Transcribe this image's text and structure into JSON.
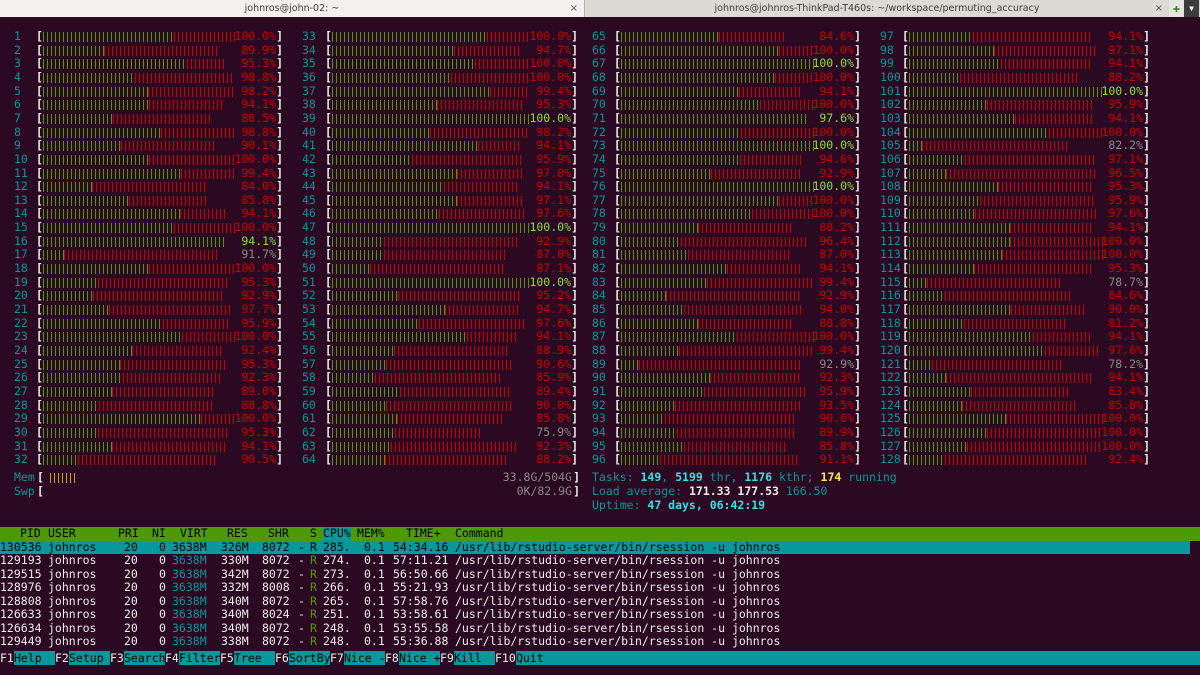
{
  "tabs": [
    {
      "title": "johnros@john-02: ~",
      "close": "×",
      "active": true
    },
    {
      "title": "johnros@johnros-ThinkPad-T460s: ~/workspace/permuting_accuracy",
      "close": "×",
      "active": false
    }
  ],
  "tab_buttons": {
    "new_tab": "✚",
    "menu": "▼"
  },
  "cpus": [
    [
      "1",
      "100.0%",
      0.68
    ],
    [
      "2",
      "89.9%",
      0.35
    ],
    [
      "3",
      "95.3%",
      0.78
    ],
    [
      "4",
      "98.8%",
      0.48
    ],
    [
      "5",
      "98.2%",
      0.55
    ],
    [
      "6",
      "94.1%",
      0.58
    ],
    [
      "7",
      "86.5%",
      0.42
    ],
    [
      "8",
      "98.8%",
      0.62
    ],
    [
      "9",
      "90.1%",
      0.45
    ],
    [
      "10",
      "100.0%",
      0.55
    ],
    [
      "11",
      "99.4%",
      0.72
    ],
    [
      "12",
      "84.0%",
      0.3
    ],
    [
      "13",
      "85.8%",
      0.52
    ],
    [
      "14",
      "94.1%",
      0.75
    ],
    [
      "15",
      "100.0%",
      0.68
    ],
    [
      "16",
      "94.1%",
      1.0
    ],
    [
      "17",
      "91.7%",
      0.12
    ],
    [
      "18",
      "100.0%",
      0.55
    ],
    [
      "19",
      "95.3%",
      0.3
    ],
    [
      "20",
      "92.9%",
      0.28
    ],
    [
      "21",
      "97.7%",
      0.35
    ],
    [
      "22",
      "95.9%",
      0.65
    ],
    [
      "23",
      "100.0%",
      0.72
    ],
    [
      "24",
      "92.4%",
      0.5
    ],
    [
      "25",
      "95.3%",
      0.42
    ],
    [
      "26",
      "92.3%",
      0.45
    ],
    [
      "27",
      "89.0%",
      0.4
    ],
    [
      "28",
      "88.8%",
      0.33
    ],
    [
      "29",
      "100.0%",
      0.82
    ],
    [
      "30",
      "95.3%",
      0.3
    ],
    [
      "31",
      "94.1%",
      0.38
    ],
    [
      "32",
      "90.5%",
      0.2
    ],
    [
      "33",
      "100.0%",
      0.78
    ],
    [
      "34",
      "94.7%",
      0.65
    ],
    [
      "35",
      "100.0%",
      0.72
    ],
    [
      "36",
      "100.0%",
      0.6
    ],
    [
      "37",
      "99.4%",
      0.8
    ],
    [
      "38",
      "95.3%",
      0.55
    ],
    [
      "39",
      "100.0%",
      1.0
    ],
    [
      "40",
      "98.2%",
      0.5
    ],
    [
      "41",
      "94.1%",
      0.78
    ],
    [
      "42",
      "95.9%",
      0.42
    ],
    [
      "43",
      "97.0%",
      0.65
    ],
    [
      "44",
      "94.1%",
      0.6
    ],
    [
      "45",
      "97.1%",
      0.65
    ],
    [
      "46",
      "97.6%",
      0.55
    ],
    [
      "47",
      "100.0%",
      1.0
    ],
    [
      "48",
      "92.9%",
      0.28
    ],
    [
      "49",
      "87.0%",
      0.3
    ],
    [
      "50",
      "87.1%",
      0.22
    ],
    [
      "51",
      "100.0%",
      1.0
    ],
    [
      "52",
      "95.2%",
      0.35
    ],
    [
      "53",
      "94.7%",
      0.6
    ],
    [
      "54",
      "97.6%",
      0.45
    ],
    [
      "55",
      "94.1%",
      0.72
    ],
    [
      "56",
      "88.9%",
      0.35
    ],
    [
      "57",
      "90.6%",
      0.3
    ],
    [
      "58",
      "85.9%",
      0.25
    ],
    [
      "59",
      "89.4%",
      0.38
    ],
    [
      "60",
      "90.0%",
      0.3
    ],
    [
      "61",
      "85.8%",
      0.38
    ],
    [
      "62",
      "75.9%",
      0.42
    ],
    [
      "63",
      "92.3%",
      0.32
    ],
    [
      "64",
      "88.2%",
      0.3
    ],
    [
      "65",
      "84.6%",
      0.6
    ],
    [
      "66",
      "100.0%",
      0.82
    ],
    [
      "67",
      "100.0%",
      1.0
    ],
    [
      "68",
      "100.0%",
      0.8
    ],
    [
      "69",
      "94.1%",
      0.65
    ],
    [
      "70",
      "100.0%",
      0.72
    ],
    [
      "71",
      "97.6%",
      1.0
    ],
    [
      "72",
      "100.0%",
      0.62
    ],
    [
      "73",
      "100.0%",
      1.0
    ],
    [
      "74",
      "94.6%",
      0.65
    ],
    [
      "75",
      "92.9%",
      0.5
    ],
    [
      "76",
      "100.0%",
      1.0
    ],
    [
      "77",
      "100.0%",
      0.82
    ],
    [
      "78",
      "100.0%",
      0.68
    ],
    [
      "79",
      "88.2%",
      0.45
    ],
    [
      "80",
      "96.4%",
      0.32
    ],
    [
      "81",
      "87.0%",
      0.4
    ],
    [
      "82",
      "94.1%",
      0.58
    ],
    [
      "83",
      "99.4%",
      0.45
    ],
    [
      "84",
      "92.9%",
      0.25
    ],
    [
      "85",
      "94.0%",
      0.35
    ],
    [
      "86",
      "88.8%",
      0.45
    ],
    [
      "87",
      "100.0%",
      0.6
    ],
    [
      "88",
      "99.4%",
      0.3
    ],
    [
      "89",
      "92.9%",
      0.1
    ],
    [
      "90",
      "92.3%",
      0.5
    ],
    [
      "91",
      "95.9%",
      0.45
    ],
    [
      "92",
      "93.5%",
      0.3
    ],
    [
      "93",
      "90.6%",
      0.25
    ],
    [
      "94",
      "89.9%",
      0.32
    ],
    [
      "95",
      "85.8%",
      0.38
    ],
    [
      "96",
      "91.1%",
      0.22
    ],
    [
      "97",
      "94.1%",
      0.35
    ],
    [
      "98",
      "97.1%",
      0.45
    ],
    [
      "99",
      "94.1%",
      0.5
    ],
    [
      "100",
      "88.2%",
      0.3
    ],
    [
      "101",
      "100.0%",
      1.0
    ],
    [
      "102",
      "95.9%",
      0.42
    ],
    [
      "103",
      "94.1%",
      0.58
    ],
    [
      "104",
      "100.0%",
      0.72
    ],
    [
      "105",
      "82.2%",
      0.08
    ],
    [
      "106",
      "97.1%",
      0.3
    ],
    [
      "107",
      "96.5%",
      0.2
    ],
    [
      "108",
      "95.3%",
      0.48
    ],
    [
      "109",
      "95.9%",
      0.38
    ],
    [
      "110",
      "97.6%",
      0.35
    ],
    [
      "111",
      "94.1%",
      0.55
    ],
    [
      "112",
      "100.0%",
      0.52
    ],
    [
      "113",
      "100.0%",
      0.48
    ],
    [
      "114",
      "95.3%",
      0.35
    ],
    [
      "115",
      "78.7%",
      0.12
    ],
    [
      "116",
      "84.6%",
      0.22
    ],
    [
      "117",
      "90.0%",
      0.58
    ],
    [
      "118",
      "81.2%",
      0.35
    ],
    [
      "119",
      "94.1%",
      0.68
    ],
    [
      "120",
      "97.6%",
      0.72
    ],
    [
      "121",
      "78.2%",
      0.15
    ],
    [
      "122",
      "94.1%",
      0.2
    ],
    [
      "123",
      "83.4%",
      0.38
    ],
    [
      "124",
      "85.8%",
      0.32
    ],
    [
      "125",
      "100.0%",
      0.5
    ],
    [
      "126",
      "100.0%",
      0.4
    ],
    [
      "127",
      "100.0%",
      0.3
    ],
    [
      "128",
      "92.4%",
      0.2
    ]
  ],
  "mem": {
    "label": "Mem",
    "value": "33.8G/504G",
    "bracket_open": "[",
    "bracket_close": "]",
    "used_fraction": 0.067
  },
  "swp": {
    "label": "Swp",
    "value": "0K/82.9G",
    "bracket_open": "[",
    "bracket_close": "]"
  },
  "tasks": {
    "label": "Tasks: ",
    "count": "149",
    "sep1": ", ",
    "thr": "5199",
    "thr_label": " thr, ",
    "kthr": "1176",
    "kthr_label": " kthr; ",
    "running": "174",
    "running_label": " running"
  },
  "load": {
    "label": "Load average: ",
    "v1": "171.33",
    "v2": "177.53",
    "v3": "166.50"
  },
  "uptime": {
    "label": "Uptime: ",
    "value": "47 days, 06:42:19"
  },
  "columns": {
    "pid": "PID",
    "user": "USER",
    "pri": "PRI",
    "ni": "NI",
    "virt": "VIRT",
    "res": "RES",
    "shr": "SHR",
    "s": "S",
    "cpu": "CPU%",
    "mem": "MEM%",
    "time": "TIME+",
    "command": "Command"
  },
  "processes": [
    {
      "pid": "130536",
      "user": "johnros",
      "pri": "20",
      "ni": "0",
      "virt": "3638M",
      "res": "326M",
      "shr": "8072",
      "dash": "-",
      "s": "R",
      "cpu": "285.",
      "mem": "0.1",
      "time": "54:34.16",
      "command": "/usr/lib/rstudio-server/bin/rsession -u johnros"
    },
    {
      "pid": "129193",
      "user": "johnros",
      "pri": "20",
      "ni": "0",
      "virt": "3638M",
      "res": "330M",
      "shr": "8072",
      "dash": "-",
      "s": "R",
      "cpu": "274.",
      "mem": "0.1",
      "time": "57:11.21",
      "command": "/usr/lib/rstudio-server/bin/rsession -u johnros"
    },
    {
      "pid": "129515",
      "user": "johnros",
      "pri": "20",
      "ni": "0",
      "virt": "3638M",
      "res": "342M",
      "shr": "8072",
      "dash": "-",
      "s": "R",
      "cpu": "273.",
      "mem": "0.1",
      "time": "56:50.66",
      "command": "/usr/lib/rstudio-server/bin/rsession -u johnros"
    },
    {
      "pid": "128976",
      "user": "johnros",
      "pri": "20",
      "ni": "0",
      "virt": "3638M",
      "res": "332M",
      "shr": "8008",
      "dash": "-",
      "s": "R",
      "cpu": "266.",
      "mem": "0.1",
      "time": "55:21.93",
      "command": "/usr/lib/rstudio-server/bin/rsession -u johnros"
    },
    {
      "pid": "128808",
      "user": "johnros",
      "pri": "20",
      "ni": "0",
      "virt": "3638M",
      "res": "340M",
      "shr": "8072",
      "dash": "-",
      "s": "R",
      "cpu": "265.",
      "mem": "0.1",
      "time": "57:58.76",
      "command": "/usr/lib/rstudio-server/bin/rsession -u johnros"
    },
    {
      "pid": "126633",
      "user": "johnros",
      "pri": "20",
      "ni": "0",
      "virt": "3638M",
      "res": "340M",
      "shr": "8024",
      "dash": "-",
      "s": "R",
      "cpu": "251.",
      "mem": "0.1",
      "time": "53:58.61",
      "command": "/usr/lib/rstudio-server/bin/rsession -u johnros"
    },
    {
      "pid": "126634",
      "user": "johnros",
      "pri": "20",
      "ni": "0",
      "virt": "3638M",
      "res": "340M",
      "shr": "8072",
      "dash": "-",
      "s": "R",
      "cpu": "248.",
      "mem": "0.1",
      "time": "53:55.58",
      "command": "/usr/lib/rstudio-server/bin/rsession -u johnros"
    },
    {
      "pid": "129449",
      "user": "johnros",
      "pri": "20",
      "ni": "0",
      "virt": "3638M",
      "res": "338M",
      "shr": "8072",
      "dash": "-",
      "s": "R",
      "cpu": "248.",
      "mem": "0.1",
      "time": "55:36.88",
      "command": "/usr/lib/rstudio-server/bin/rsession -u johnros"
    }
  ],
  "fkeys": [
    {
      "key": "F1",
      "label": "Help"
    },
    {
      "key": "F2",
      "label": "Setup"
    },
    {
      "key": "F3",
      "label": "Search"
    },
    {
      "key": "F4",
      "label": "Filter"
    },
    {
      "key": "F5",
      "label": "Tree"
    },
    {
      "key": "F6",
      "label": "SortBy"
    },
    {
      "key": "F7",
      "label": "Nice -"
    },
    {
      "key": "F8",
      "label": "Nice +"
    },
    {
      "key": "F9",
      "label": "Kill"
    },
    {
      "key": "F10",
      "label": "Quit"
    }
  ],
  "colors": {
    "bg": "#2c0922",
    "cyan": "#06989a",
    "green": "#4e9a06",
    "red": "#cc0000",
    "header": "#4e9a06"
  }
}
